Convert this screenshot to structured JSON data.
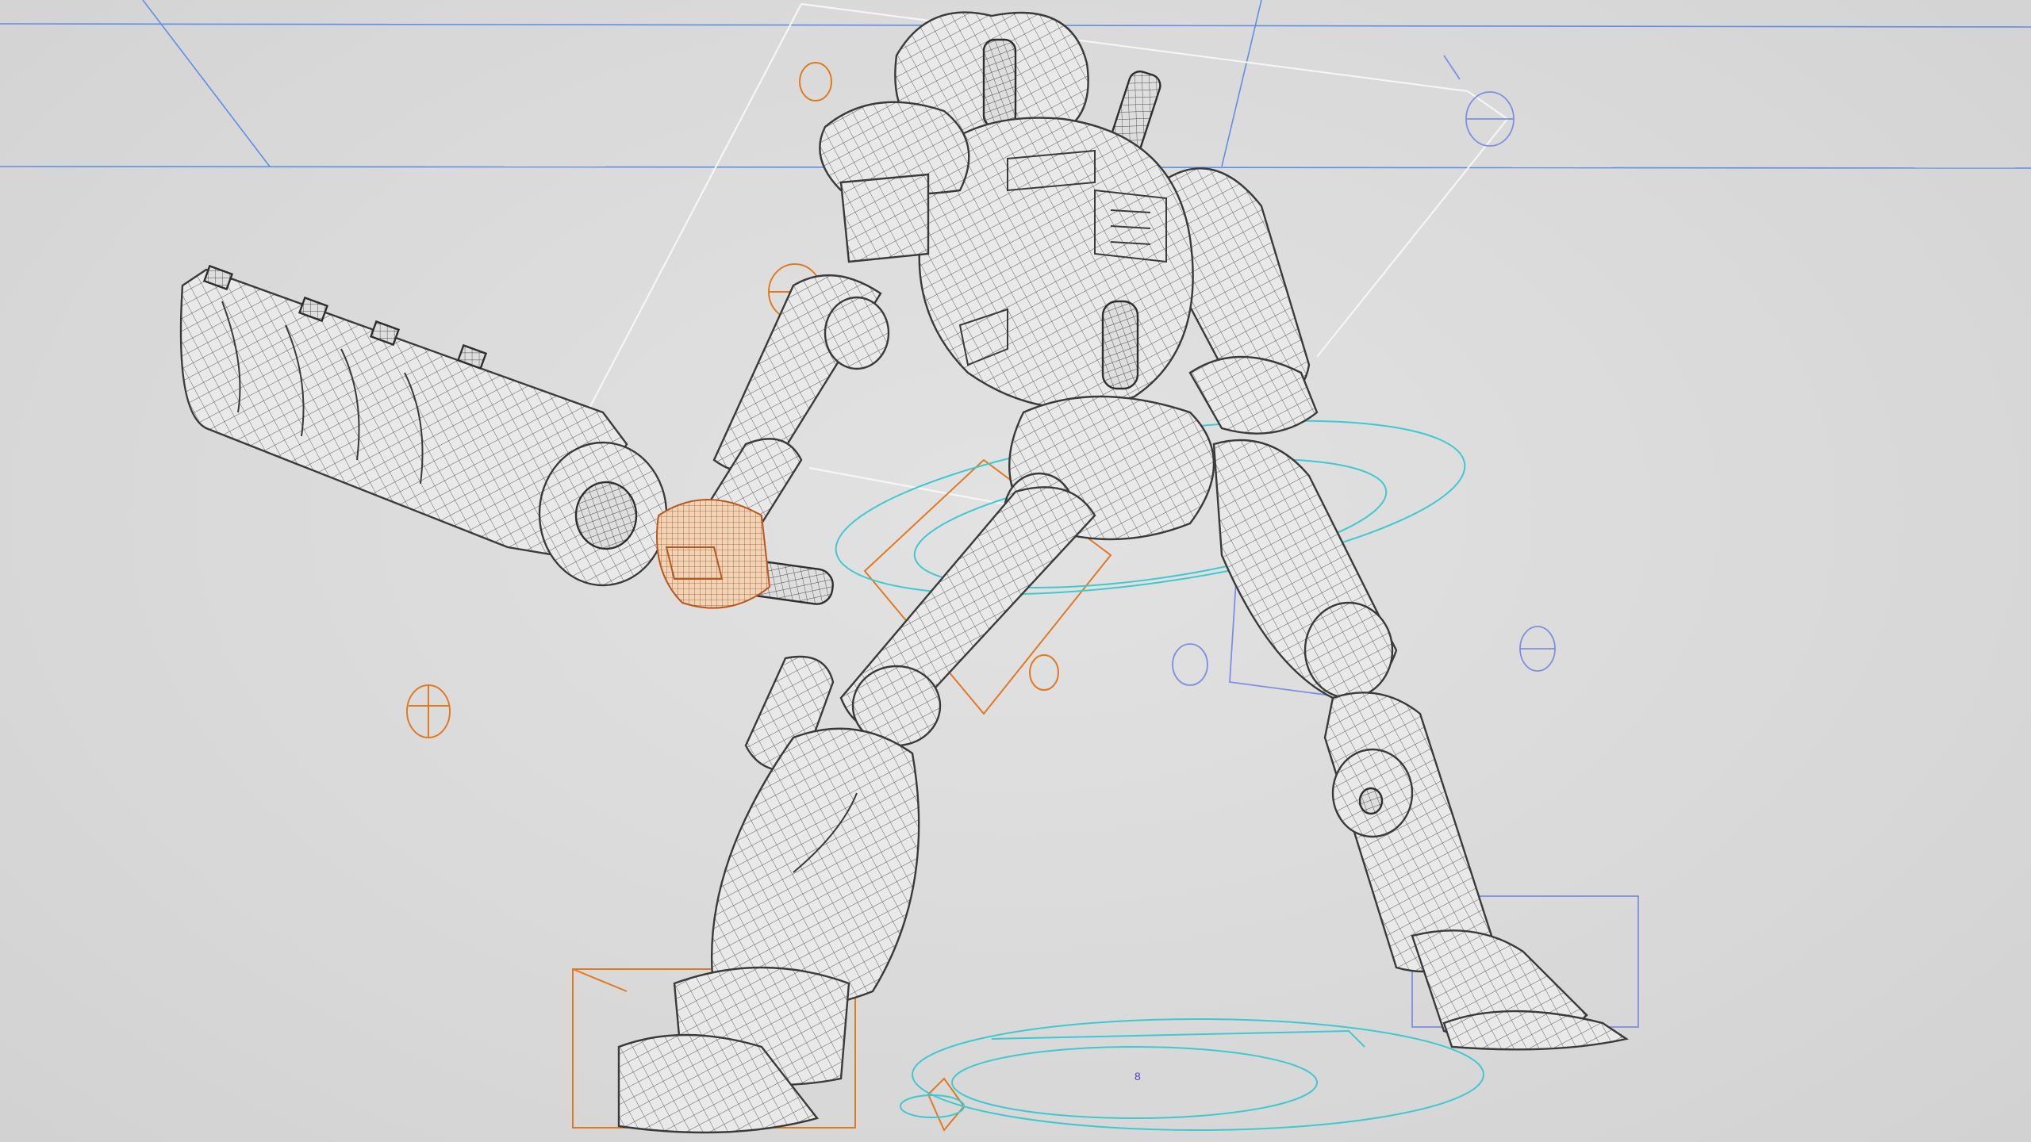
{
  "viewport": {
    "mode": "wireframe-on-shaded",
    "background_color": "#dcdcdc",
    "wire_color": "#3a3a3a",
    "control_colors": {
      "orange": "#e07a22",
      "cyan": "#3fc9cf",
      "blue": "#7f8fe0",
      "white": "#f6f6f6",
      "guide": "#5f8fe2"
    }
  },
  "origin_marker": {
    "label": "8"
  }
}
